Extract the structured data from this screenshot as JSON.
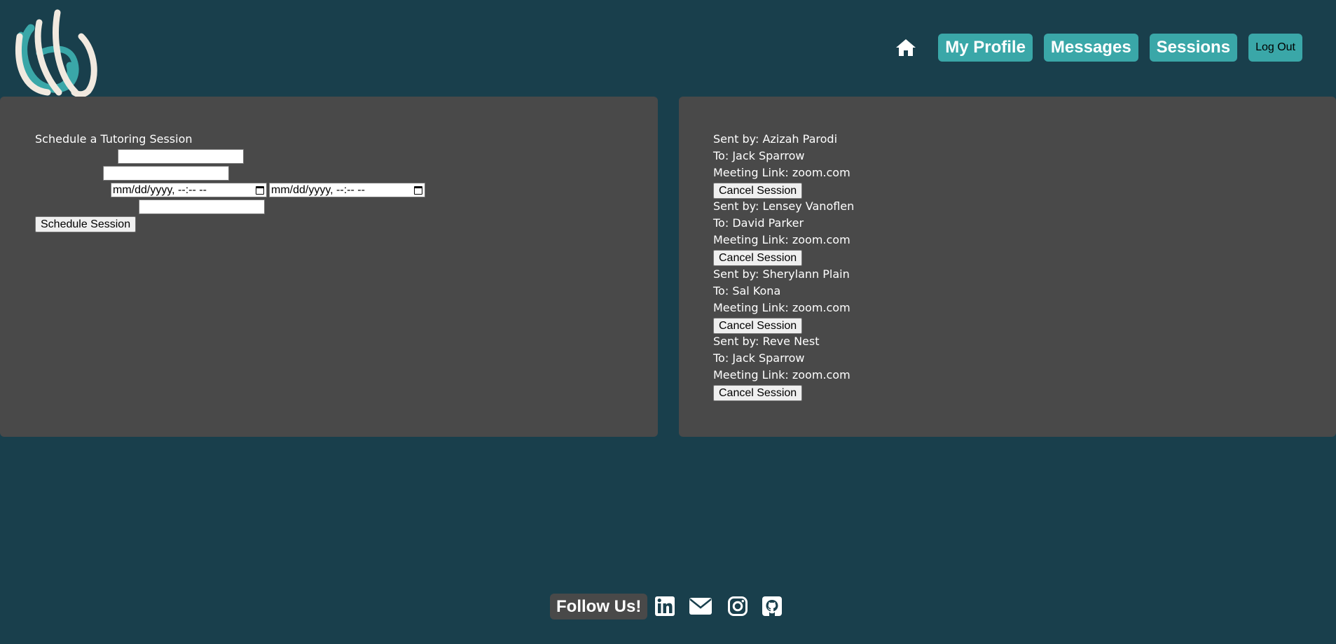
{
  "nav": {
    "home_icon": "home-icon",
    "items": [
      {
        "label": "My Profile"
      },
      {
        "label": "Messages"
      },
      {
        "label": "Sessions"
      }
    ],
    "logout_label": "Log Out"
  },
  "schedule": {
    "heading": "Schedule a Tutoring Session",
    "start_datetime_placeholder": "mm/dd/yyyy, --:-- --",
    "end_datetime_placeholder": "mm/dd/yyyy, --:-- --",
    "submit_label": "Schedule Session"
  },
  "sessions": [
    {
      "sent_by": "Sent by: Azizah Parodi",
      "to": "To: Jack Sparrow",
      "link": "Meeting Link: zoom.com",
      "cancel_label": "Cancel Session"
    },
    {
      "sent_by": "Sent by: Lensey Vanoflen",
      "to": "To: David Parker",
      "link": "Meeting Link: zoom.com",
      "cancel_label": "Cancel Session"
    },
    {
      "sent_by": "Sent by: Sherylann Plain",
      "to": "To: Sal Kona",
      "link": "Meeting Link: zoom.com",
      "cancel_label": "Cancel Session"
    },
    {
      "sent_by": "Sent by: Reve Nest",
      "to": "To: Jack Sparrow",
      "link": "Meeting Link: zoom.com",
      "cancel_label": "Cancel Session"
    }
  ],
  "footer": {
    "follow_label": "Follow Us!",
    "social_icons": [
      "linkedin-icon",
      "mail-icon",
      "instagram-icon",
      "github-icon"
    ]
  },
  "colors": {
    "background": "#193f4c",
    "panel": "#494949",
    "accent": "#3aa7a8"
  }
}
